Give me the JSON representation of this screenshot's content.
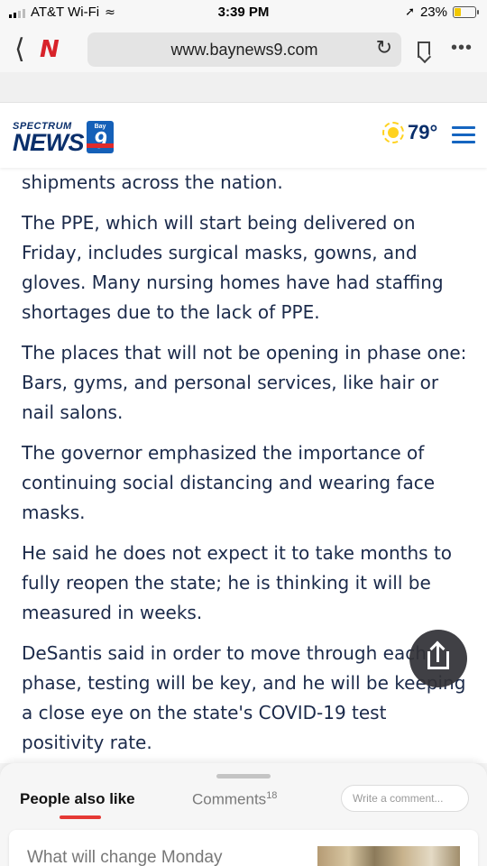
{
  "status_bar": {
    "carrier": "AT&T Wi-Fi",
    "time": "3:39 PM",
    "battery": "23%"
  },
  "browser": {
    "url": "www.baynews9.com"
  },
  "site": {
    "logo_brand": "SPECTRUM",
    "logo_name": "NEWS",
    "logo_badge_text": "Bay",
    "logo_badge_number": "9",
    "temperature": "79°"
  },
  "article": {
    "paragraphs": [
      "shipments across the nation.",
      "The PPE, which will start being delivered on Friday, includes surgical masks, gowns, and gloves. Many nursing homes have had staffing shortages due to the lack of PPE.",
      "The places that will not be opening in phase one: Bars, gyms, and personal services, like hair or nail salons.",
      "The governor emphasized the importance of continuing social distancing and wearing face masks.",
      "He said he does not expect it to take months to fully reopen the state; he is thinking it will be measured in weeks.",
      "DeSantis said in order to move through each phase, testing will be key, and he will be keeping a close eye on the state's COVID-19 test positivity rate."
    ]
  },
  "sheet": {
    "tab_people": "People also like",
    "tab_comments": "Comments",
    "comments_count": "18",
    "comment_placeholder": "Write a comment...",
    "card_title": "What will change Monday"
  },
  "colors": {
    "brand_navy": "#0a2f6b",
    "accent_red": "#e53935",
    "menu_blue": "#1565c0",
    "sun_yellow": "#ffd21f"
  }
}
